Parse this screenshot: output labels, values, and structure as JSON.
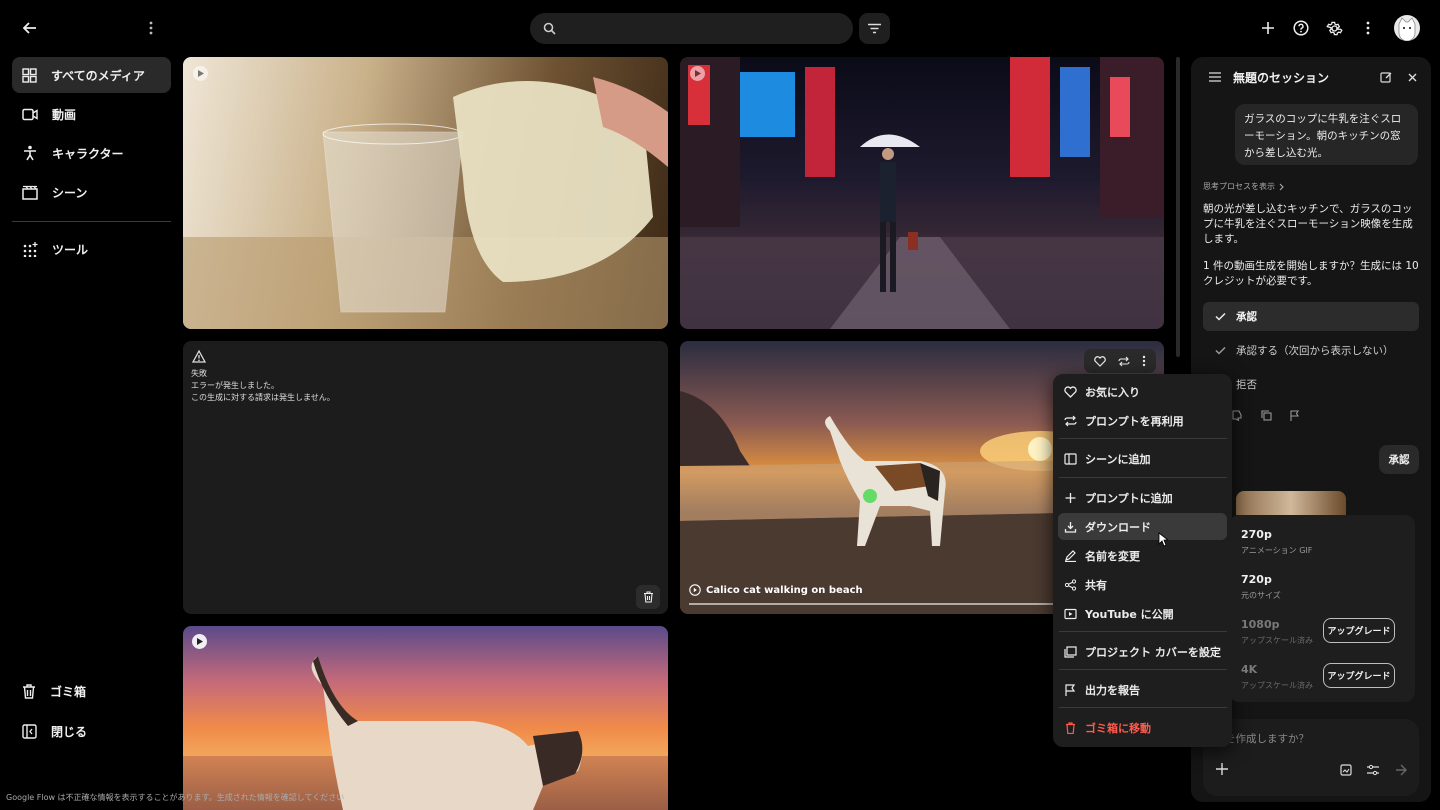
{
  "search": {
    "placeholder": ""
  },
  "sidebar": {
    "items": [
      {
        "label": "すべてのメディア",
        "icon": "grid-icon",
        "active": true
      },
      {
        "label": "動画",
        "icon": "video-icon"
      },
      {
        "label": "キャラクター",
        "icon": "person-icon"
      },
      {
        "label": "シーン",
        "icon": "clapperboard-icon"
      }
    ],
    "tools_label": "ツール",
    "trash_label": "ゴミ箱",
    "close_label": "閉じる"
  },
  "media": {
    "failed": {
      "status": "失敗",
      "error": "エラーが発生しました。",
      "note": "この生成に対する請求は発生しません。"
    },
    "cat_card_title": "Calico cat walking on beach"
  },
  "context_menu": {
    "items": [
      {
        "label": "お気に入り",
        "icon": "heart-icon"
      },
      {
        "label": "プロンプトを再利用",
        "icon": "reuse-icon"
      },
      {
        "label": "シーンに追加",
        "icon": "scene-add-icon"
      },
      {
        "label": "プロンプトに追加",
        "icon": "plus-icon"
      },
      {
        "label": "ダウンロード",
        "icon": "download-icon",
        "highlighted": true
      },
      {
        "label": "名前を変更",
        "icon": "pencil-icon"
      },
      {
        "label": "共有",
        "icon": "share-icon"
      },
      {
        "label": "YouTube に公開",
        "icon": "youtube-icon"
      },
      {
        "label": "プロジェクト カバーを設定",
        "icon": "cover-icon"
      },
      {
        "label": "出力を報告",
        "icon": "flag-icon"
      },
      {
        "label": "ゴミ箱に移動",
        "icon": "trash-icon",
        "danger": true
      }
    ]
  },
  "download_menu": {
    "options": [
      {
        "res": "270p",
        "sub": "アニメーション GIF"
      },
      {
        "res": "720p",
        "sub": "元のサイズ"
      },
      {
        "res": "1080p",
        "sub": "アップスケール済み",
        "button": "アップグレード"
      },
      {
        "res": "4K",
        "sub": "アップスケール済み",
        "button": "アップグレード"
      }
    ]
  },
  "session": {
    "title": "無題のセッション",
    "user_message": "ガラスのコップに牛乳を注ぐスローモーション。朝のキッチンの窓から差し込む光。",
    "thinking_label": "思考プロセスを表示",
    "reply_1": "朝の光が差し込むキッチンで、ガラスのコップに牛乳を注ぐスローモーション映像を生成します。",
    "reply_2": "1 件の動画生成を開始しますか？生成には 10 クレジットが必要です。",
    "option_approve": "承認",
    "option_approve_always": "承認する（次回から表示しない）",
    "option_reject": "拒否",
    "approve_chip": "承認",
    "composer_placeholder": "を作成しますか？"
  },
  "footer": {
    "disclaimer": "Google Flow は不正確な情報を表示することがあります。生成された情報を確認してください"
  },
  "colors": {
    "danger": "#ff5a4d",
    "panel": "#151515",
    "menu": "#1e1e1e"
  }
}
